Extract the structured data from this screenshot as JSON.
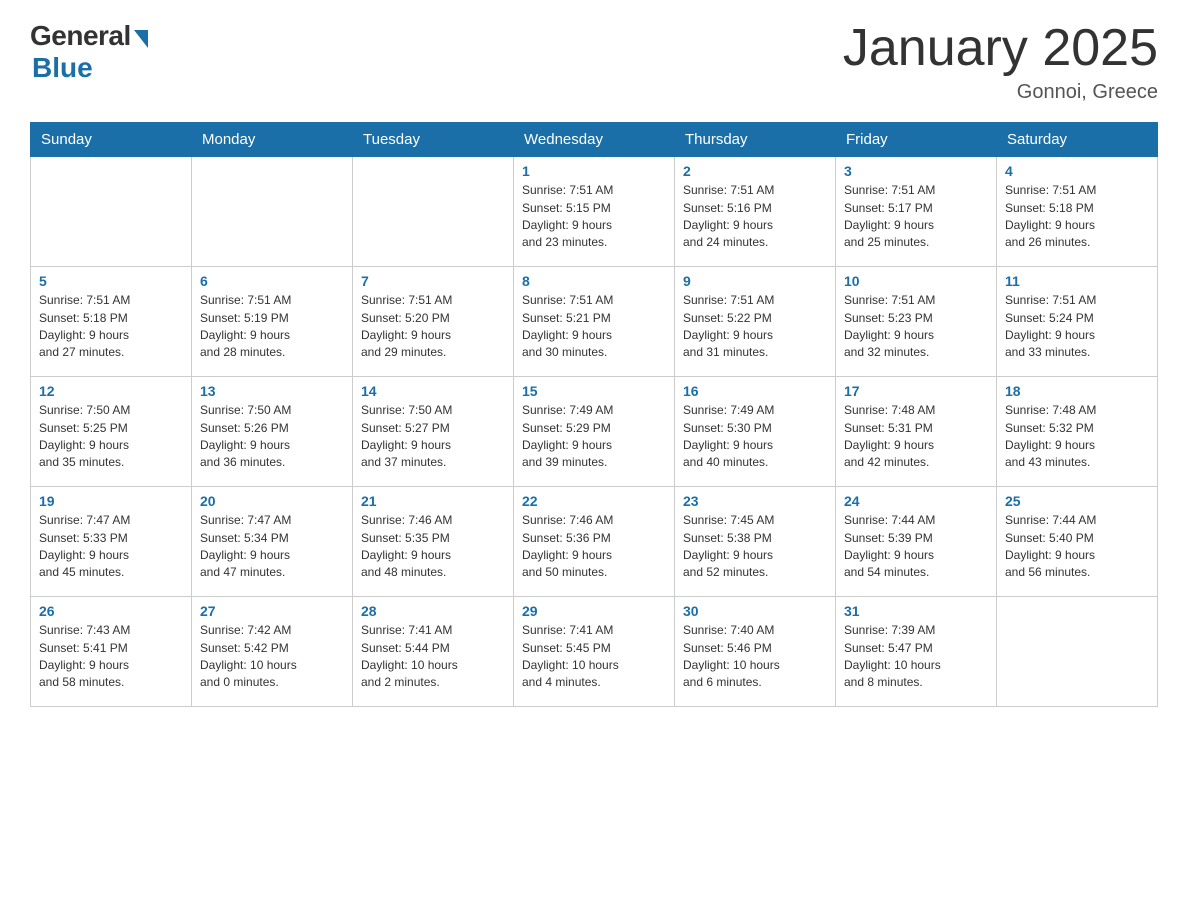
{
  "logo": {
    "general": "General",
    "blue": "Blue"
  },
  "title": "January 2025",
  "subtitle": "Gonnoi, Greece",
  "days_of_week": [
    "Sunday",
    "Monday",
    "Tuesday",
    "Wednesday",
    "Thursday",
    "Friday",
    "Saturday"
  ],
  "weeks": [
    [
      {
        "day": "",
        "info": ""
      },
      {
        "day": "",
        "info": ""
      },
      {
        "day": "",
        "info": ""
      },
      {
        "day": "1",
        "info": "Sunrise: 7:51 AM\nSunset: 5:15 PM\nDaylight: 9 hours\nand 23 minutes."
      },
      {
        "day": "2",
        "info": "Sunrise: 7:51 AM\nSunset: 5:16 PM\nDaylight: 9 hours\nand 24 minutes."
      },
      {
        "day": "3",
        "info": "Sunrise: 7:51 AM\nSunset: 5:17 PM\nDaylight: 9 hours\nand 25 minutes."
      },
      {
        "day": "4",
        "info": "Sunrise: 7:51 AM\nSunset: 5:18 PM\nDaylight: 9 hours\nand 26 minutes."
      }
    ],
    [
      {
        "day": "5",
        "info": "Sunrise: 7:51 AM\nSunset: 5:18 PM\nDaylight: 9 hours\nand 27 minutes."
      },
      {
        "day": "6",
        "info": "Sunrise: 7:51 AM\nSunset: 5:19 PM\nDaylight: 9 hours\nand 28 minutes."
      },
      {
        "day": "7",
        "info": "Sunrise: 7:51 AM\nSunset: 5:20 PM\nDaylight: 9 hours\nand 29 minutes."
      },
      {
        "day": "8",
        "info": "Sunrise: 7:51 AM\nSunset: 5:21 PM\nDaylight: 9 hours\nand 30 minutes."
      },
      {
        "day": "9",
        "info": "Sunrise: 7:51 AM\nSunset: 5:22 PM\nDaylight: 9 hours\nand 31 minutes."
      },
      {
        "day": "10",
        "info": "Sunrise: 7:51 AM\nSunset: 5:23 PM\nDaylight: 9 hours\nand 32 minutes."
      },
      {
        "day": "11",
        "info": "Sunrise: 7:51 AM\nSunset: 5:24 PM\nDaylight: 9 hours\nand 33 minutes."
      }
    ],
    [
      {
        "day": "12",
        "info": "Sunrise: 7:50 AM\nSunset: 5:25 PM\nDaylight: 9 hours\nand 35 minutes."
      },
      {
        "day": "13",
        "info": "Sunrise: 7:50 AM\nSunset: 5:26 PM\nDaylight: 9 hours\nand 36 minutes."
      },
      {
        "day": "14",
        "info": "Sunrise: 7:50 AM\nSunset: 5:27 PM\nDaylight: 9 hours\nand 37 minutes."
      },
      {
        "day": "15",
        "info": "Sunrise: 7:49 AM\nSunset: 5:29 PM\nDaylight: 9 hours\nand 39 minutes."
      },
      {
        "day": "16",
        "info": "Sunrise: 7:49 AM\nSunset: 5:30 PM\nDaylight: 9 hours\nand 40 minutes."
      },
      {
        "day": "17",
        "info": "Sunrise: 7:48 AM\nSunset: 5:31 PM\nDaylight: 9 hours\nand 42 minutes."
      },
      {
        "day": "18",
        "info": "Sunrise: 7:48 AM\nSunset: 5:32 PM\nDaylight: 9 hours\nand 43 minutes."
      }
    ],
    [
      {
        "day": "19",
        "info": "Sunrise: 7:47 AM\nSunset: 5:33 PM\nDaylight: 9 hours\nand 45 minutes."
      },
      {
        "day": "20",
        "info": "Sunrise: 7:47 AM\nSunset: 5:34 PM\nDaylight: 9 hours\nand 47 minutes."
      },
      {
        "day": "21",
        "info": "Sunrise: 7:46 AM\nSunset: 5:35 PM\nDaylight: 9 hours\nand 48 minutes."
      },
      {
        "day": "22",
        "info": "Sunrise: 7:46 AM\nSunset: 5:36 PM\nDaylight: 9 hours\nand 50 minutes."
      },
      {
        "day": "23",
        "info": "Sunrise: 7:45 AM\nSunset: 5:38 PM\nDaylight: 9 hours\nand 52 minutes."
      },
      {
        "day": "24",
        "info": "Sunrise: 7:44 AM\nSunset: 5:39 PM\nDaylight: 9 hours\nand 54 minutes."
      },
      {
        "day": "25",
        "info": "Sunrise: 7:44 AM\nSunset: 5:40 PM\nDaylight: 9 hours\nand 56 minutes."
      }
    ],
    [
      {
        "day": "26",
        "info": "Sunrise: 7:43 AM\nSunset: 5:41 PM\nDaylight: 9 hours\nand 58 minutes."
      },
      {
        "day": "27",
        "info": "Sunrise: 7:42 AM\nSunset: 5:42 PM\nDaylight: 10 hours\nand 0 minutes."
      },
      {
        "day": "28",
        "info": "Sunrise: 7:41 AM\nSunset: 5:44 PM\nDaylight: 10 hours\nand 2 minutes."
      },
      {
        "day": "29",
        "info": "Sunrise: 7:41 AM\nSunset: 5:45 PM\nDaylight: 10 hours\nand 4 minutes."
      },
      {
        "day": "30",
        "info": "Sunrise: 7:40 AM\nSunset: 5:46 PM\nDaylight: 10 hours\nand 6 minutes."
      },
      {
        "day": "31",
        "info": "Sunrise: 7:39 AM\nSunset: 5:47 PM\nDaylight: 10 hours\nand 8 minutes."
      },
      {
        "day": "",
        "info": ""
      }
    ]
  ]
}
